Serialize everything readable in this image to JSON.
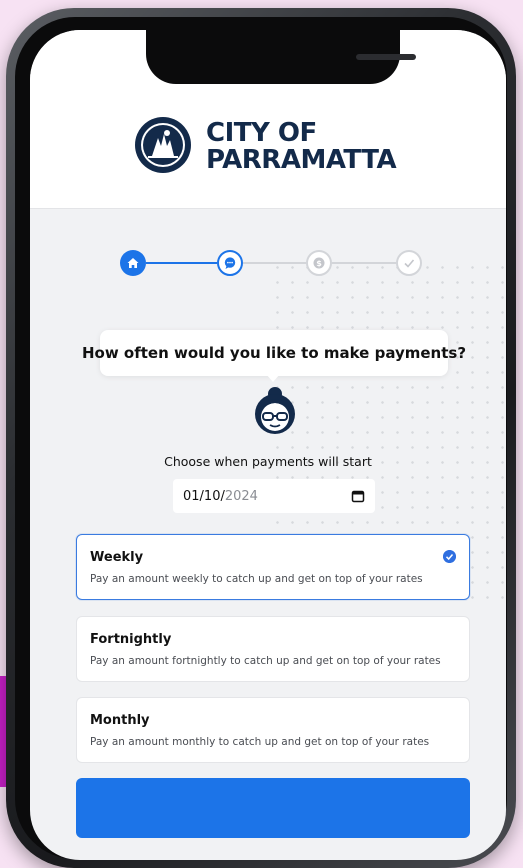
{
  "brand": {
    "name_line1": "CITY OF",
    "name_line2": "PARRAMATTA",
    "color": "#132a4a"
  },
  "stepper": {
    "steps": [
      {
        "icon": "home-icon",
        "state": "complete"
      },
      {
        "icon": "chat-icon",
        "state": "active"
      },
      {
        "icon": "dollar-icon",
        "state": "inactive"
      },
      {
        "icon": "check-icon",
        "state": "inactive"
      }
    ],
    "active_color": "#1c74e8",
    "inactive_color": "#c9cbd0"
  },
  "question": "How often would you like to make payments?",
  "start": {
    "label": "Choose when payments will start",
    "date_value": "01/10/",
    "date_year": "2024"
  },
  "options": [
    {
      "title": "Weekly",
      "description": "Pay an amount weekly to catch up and get on top of your rates",
      "selected": true
    },
    {
      "title": "Fortnightly",
      "description": "Pay an amount fortnightly to catch up and get on top of your rates",
      "selected": false
    },
    {
      "title": "Monthly",
      "description": "Pay an amount monthly to catch up and get on top of your rates",
      "selected": false
    }
  ],
  "colors": {
    "accent": "#1c74e8",
    "background": "#f7e2f3",
    "screen": "#f1f2f4"
  }
}
